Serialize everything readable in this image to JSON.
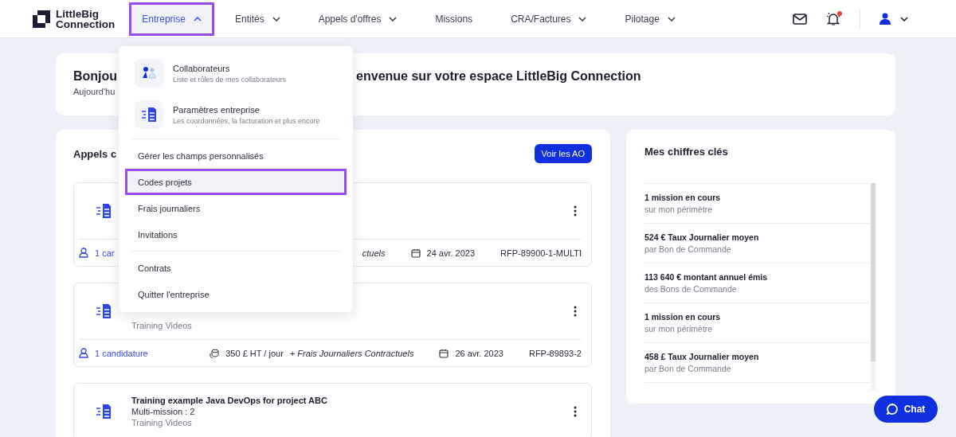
{
  "header": {
    "logo": [
      "LittleBig",
      "Connection"
    ],
    "nav": [
      {
        "label": "Entreprise",
        "selected": true,
        "dropdown": true
      },
      {
        "label": "Entités",
        "selected": false,
        "dropdown": true
      },
      {
        "label": "Appels d'offres",
        "selected": false,
        "dropdown": true
      },
      {
        "label": "Missions",
        "selected": false,
        "dropdown": false
      },
      {
        "label": "CRA/Factures",
        "selected": false,
        "dropdown": true
      },
      {
        "label": "Pilotage",
        "selected": false,
        "dropdown": true
      }
    ],
    "notification": true
  },
  "menu": [
    {
      "kind": "entry",
      "label": "Collaborateurs",
      "subtitle": "Liste et rôles de mes collaborateurs",
      "selected": false
    },
    {
      "kind": "entry",
      "label": "Paramètres entreprise",
      "subtitle": "Les coordonnées, la facturation et plus encore",
      "selected": false
    },
    {
      "kind": "divider"
    },
    {
      "kind": "link",
      "label": "Gérer les champs personnalisés",
      "selected": false
    },
    {
      "kind": "link",
      "label": "Codes projets",
      "selected": true
    },
    {
      "kind": "link",
      "label": "Frais journaliers",
      "selected": false
    },
    {
      "kind": "link",
      "label": "Invitations",
      "selected": false
    },
    {
      "kind": "divider"
    },
    {
      "kind": "link",
      "label": "Contrats",
      "selected": false
    },
    {
      "kind": "link",
      "label": "Quitter l'entreprise",
      "selected": false
    }
  ],
  "welcome": {
    "greeting_start": "Bonjou",
    "greeting_end": "envenue sur votre espace LittleBig Connection",
    "subtitle": "Aujourd'hu"
  },
  "tenders": {
    "title": "Appels c",
    "button": "Voir les AO",
    "rows": [
      {
        "footer": {
          "candidates": "1 car",
          "price": "ctuels",
          "date": "24 avr. 2023",
          "reference": "RFP-89900-1-MULTI"
        }
      },
      {
        "lines": [
          "Training Videos"
        ],
        "footer": {
          "candidates": "1 candidature",
          "price": "350 £ HT / jour",
          "price_extra": "+ Frais Journaliers Contractuels",
          "date": "26 avr. 2023",
          "reference": "RFP-89893-2"
        }
      },
      {
        "title": "Training example Java DevOps for project ABC",
        "lines": [
          "Multi-mission : 2",
          "Training Videos"
        ]
      }
    ]
  },
  "key_figures": {
    "title": "Mes chiffres clés",
    "items": [
      {
        "value": "1 mission en cours",
        "caption": "sur mon périmètre"
      },
      {
        "value": "524 € Taux Journalier moyen",
        "caption": "par Bon de Commande"
      },
      {
        "value": "113 640 € montant annuel émis",
        "caption": "des Bons de Commande"
      },
      {
        "value": "1 mission en cours",
        "caption": "sur mon périmètre"
      },
      {
        "value": "458 £ Taux Journalier moyen",
        "caption": "par Bon de Commande"
      }
    ]
  },
  "chat": "Chat"
}
